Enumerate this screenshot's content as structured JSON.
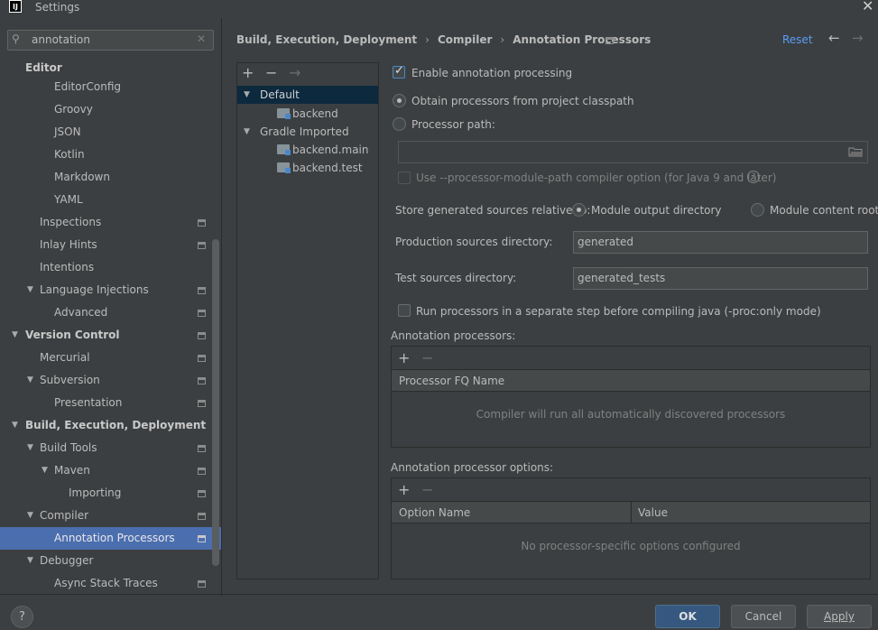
{
  "window": {
    "title": "Settings",
    "app_logo": "IJ"
  },
  "search": {
    "value": "annotation",
    "placeholder": ""
  },
  "sidebar": {
    "items": [
      {
        "label": "Editor"
      },
      {
        "label": "EditorConfig"
      },
      {
        "label": "Groovy"
      },
      {
        "label": "JSON"
      },
      {
        "label": "Kotlin"
      },
      {
        "label": "Markdown"
      },
      {
        "label": "YAML"
      },
      {
        "label": "Inspections"
      },
      {
        "label": "Inlay Hints"
      },
      {
        "label": "Intentions"
      },
      {
        "label": "Language Injections"
      },
      {
        "label": "Advanced"
      },
      {
        "label": "Version Control"
      },
      {
        "label": "Mercurial"
      },
      {
        "label": "Subversion"
      },
      {
        "label": "Presentation"
      },
      {
        "label": "Build, Execution, Deployment"
      },
      {
        "label": "Build Tools"
      },
      {
        "label": "Maven"
      },
      {
        "label": "Importing"
      },
      {
        "label": "Compiler"
      },
      {
        "label": "Annotation Processors"
      },
      {
        "label": "Debugger"
      },
      {
        "label": "Async Stack Traces"
      }
    ]
  },
  "header": {
    "breadcrumb": [
      "Build, Execution, Deployment",
      "Compiler",
      "Annotation Processors"
    ],
    "reset_label": "Reset"
  },
  "profiles": {
    "add": "+",
    "remove": "−",
    "move": "→",
    "items": [
      {
        "label": "Default"
      },
      {
        "label": "backend"
      },
      {
        "label": "Gradle Imported"
      },
      {
        "label": "backend.main"
      },
      {
        "label": "backend.test"
      }
    ]
  },
  "form": {
    "enable_label": "Enable annotation processing",
    "obtain_label": "Obtain processors from project classpath",
    "processor_path_label": "Processor path:",
    "processor_path_value": "",
    "module_path_label": "Use --processor-module-path compiler option (for Java 9 and later)",
    "store_label": "Store generated sources relative to:",
    "module_output_label": "Module output directory",
    "module_content_label": "Module content root",
    "prod_dir_label": "Production sources directory:",
    "prod_dir_value": "generated",
    "test_dir_label": "Test sources directory:",
    "test_dir_value": "generated_tests",
    "separate_step_label": "Run processors in a separate step before compiling java (-proc:only mode)",
    "processors_section_label": "Annotation processors:",
    "processors_column": "Processor FQ Name",
    "processors_empty": "Compiler will run all automatically discovered processors",
    "options_section_label": "Annotation processor options:",
    "options_columns": [
      "Option Name",
      "Value"
    ],
    "options_empty": "No processor-specific options configured"
  },
  "footer": {
    "help": "?",
    "ok": "OK",
    "cancel": "Cancel",
    "apply": "Apply"
  },
  "colors": {
    "background": "#3c3f41",
    "selection": "#4b6eaf",
    "link": "#589df6",
    "primary_button": "#365880"
  }
}
